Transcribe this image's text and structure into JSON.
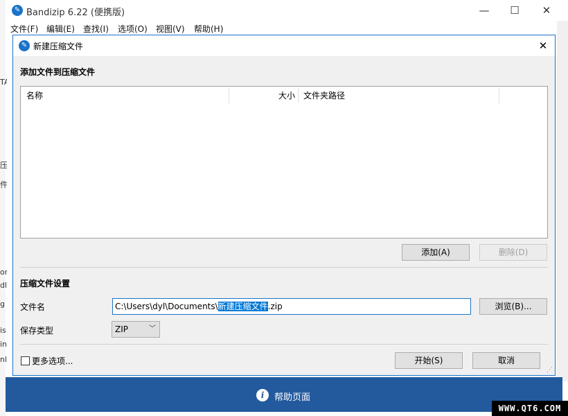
{
  "app": {
    "title": "Bandizip 6.22 (便携版)",
    "menu": [
      "文件(F)",
      "编辑(E)",
      "查找(I)",
      "选项(O)",
      "视图(V)",
      "帮助(H)"
    ],
    "window_controls": {
      "minimize": "—",
      "maximize": "☐",
      "close": "✕"
    },
    "left_peek": [
      "TA",
      "压",
      "件",
      "or",
      "dl",
      "g",
      "is",
      "in",
      "nl"
    ],
    "help_label": "帮助页面",
    "watermark": "WWW.QT6.COM"
  },
  "dialog": {
    "title": "新建压缩文件",
    "close": "✕",
    "add_files_section": "添加文件到压缩文件",
    "columns": {
      "name": "名称",
      "size": "大小",
      "path": "文件夹路径"
    },
    "add_button": "添加(A)",
    "delete_button": "删除(D)",
    "settings_section": "压缩文件设置",
    "filename_label": "文件名",
    "filename_prefix": "C:\\Users\\dyl\\Documents\\",
    "filename_selected": "新建压缩文件",
    "filename_suffix": ".zip",
    "browse_button": "浏览(B)...",
    "save_type_label": "保存类型",
    "save_type_value": "ZIP",
    "more_options": "更多选项...",
    "start_button": "开始(S)",
    "cancel_button": "取消"
  },
  "colors": {
    "accent": "#1a73c8",
    "bottom_bar": "#235a9e",
    "selection": "#0078d7"
  }
}
